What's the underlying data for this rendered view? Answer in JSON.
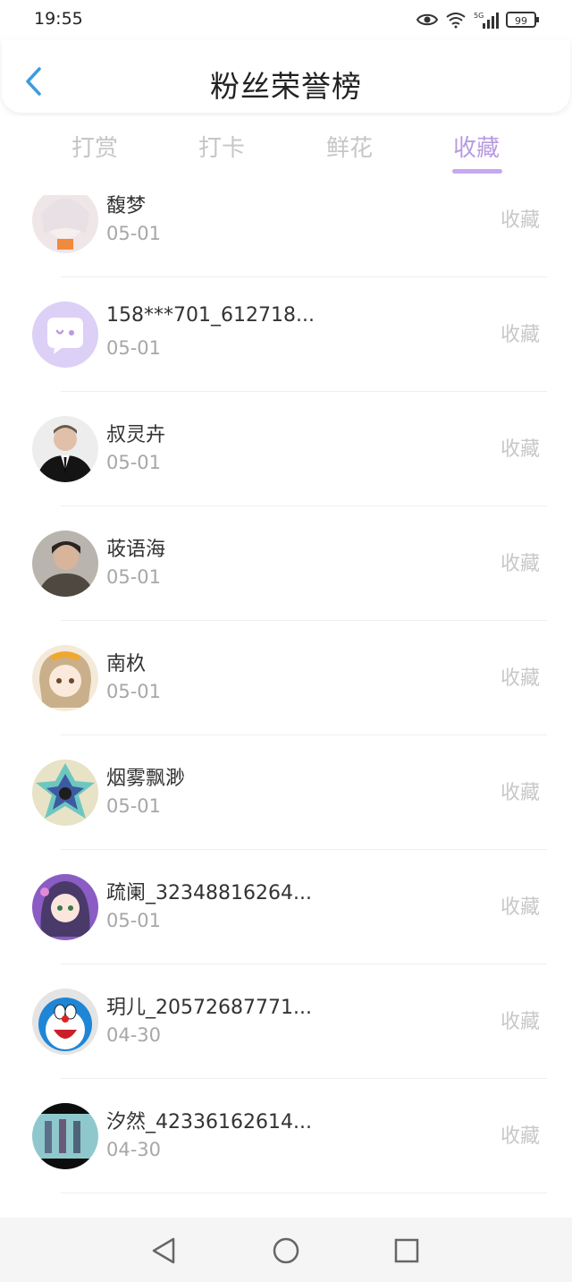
{
  "status": {
    "time": "19:55",
    "signal_label": "5G",
    "battery": "99"
  },
  "header": {
    "title": "粉丝荣誉榜"
  },
  "tabs": [
    {
      "label": "打赏",
      "active": false
    },
    {
      "label": "打卡",
      "active": false
    },
    {
      "label": "鲜花",
      "active": false
    },
    {
      "label": "收藏",
      "active": true
    }
  ],
  "colors": {
    "accent": "#b89be0",
    "underline": "#c6a8ee",
    "inactive_tab": "#c6c6c6",
    "muted_text": "#a7a7a7"
  },
  "rows": [
    {
      "name": "馥梦",
      "date": "05-01",
      "type": "收藏",
      "avatar": "anime-girl-white-hair"
    },
    {
      "name": "158***701_612718...",
      "date": "05-01",
      "type": "收藏",
      "avatar": "default-chat-bubble"
    },
    {
      "name": "叔灵卉",
      "date": "05-01",
      "type": "收藏",
      "avatar": "man-in-suit"
    },
    {
      "name": "荍语海",
      "date": "05-01",
      "type": "收藏",
      "avatar": "young-man-portrait"
    },
    {
      "name": "南杦",
      "date": "05-01",
      "type": "收藏",
      "avatar": "anime-girl-blonde"
    },
    {
      "name": "烟雾飘渺",
      "date": "05-01",
      "type": "收藏",
      "avatar": "colorful-crystal"
    },
    {
      "name": "疏阑_32348816264...",
      "date": "05-01",
      "type": "收藏",
      "avatar": "anime-girl-purple"
    },
    {
      "name": "玥儿_20572687771...",
      "date": "04-30",
      "type": "收藏",
      "avatar": "doraemon"
    },
    {
      "name": "汐然_42336162614...",
      "date": "04-30",
      "type": "收藏",
      "avatar": "group-photo"
    },
    {
      "name": "",
      "date": "",
      "type": "",
      "avatar": "pink-partial"
    }
  ],
  "navbar": {
    "back_icon": "triangle-back-icon",
    "home_icon": "circle-home-icon",
    "recent_icon": "square-recent-icon"
  }
}
